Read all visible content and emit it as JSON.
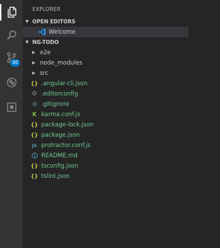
{
  "explorer": {
    "title": "EXPLORER",
    "open_editors": {
      "label": "OPEN EDITORS",
      "items": [
        {
          "label": "Welcome",
          "icon": "vscode-icon",
          "selected": true
        }
      ]
    },
    "project": {
      "label": "NG-TODO",
      "folders": [
        {
          "label": "e2e"
        },
        {
          "label": "node_modules"
        },
        {
          "label": "src"
        }
      ],
      "files": [
        {
          "label": ".angular-cli.json",
          "icon": "json-icon"
        },
        {
          "label": ".editorconfig",
          "icon": "gear-icon"
        },
        {
          "label": ".gitignore",
          "icon": "git-icon"
        },
        {
          "label": "karma.conf.js",
          "icon": "karma-icon"
        },
        {
          "label": "package-lock.json",
          "icon": "json-icon"
        },
        {
          "label": "package.json",
          "icon": "json-icon"
        },
        {
          "label": "protractor.conf.js",
          "icon": "js-icon"
        },
        {
          "label": "README.md",
          "icon": "info-icon"
        },
        {
          "label": "tsconfig.json",
          "icon": "json-icon"
        },
        {
          "label": "tslint.json",
          "icon": "json-icon"
        }
      ]
    }
  },
  "activity_bar": {
    "items": [
      "files-icon",
      "search-icon",
      "source-control-icon",
      "debug-icon",
      "extensions-icon"
    ],
    "source_control_badge": "30"
  },
  "colors": {
    "sidebar_bg": "#252526",
    "activity_bg": "#333333",
    "badge": "#007acc",
    "modified_text": "#73c991"
  }
}
